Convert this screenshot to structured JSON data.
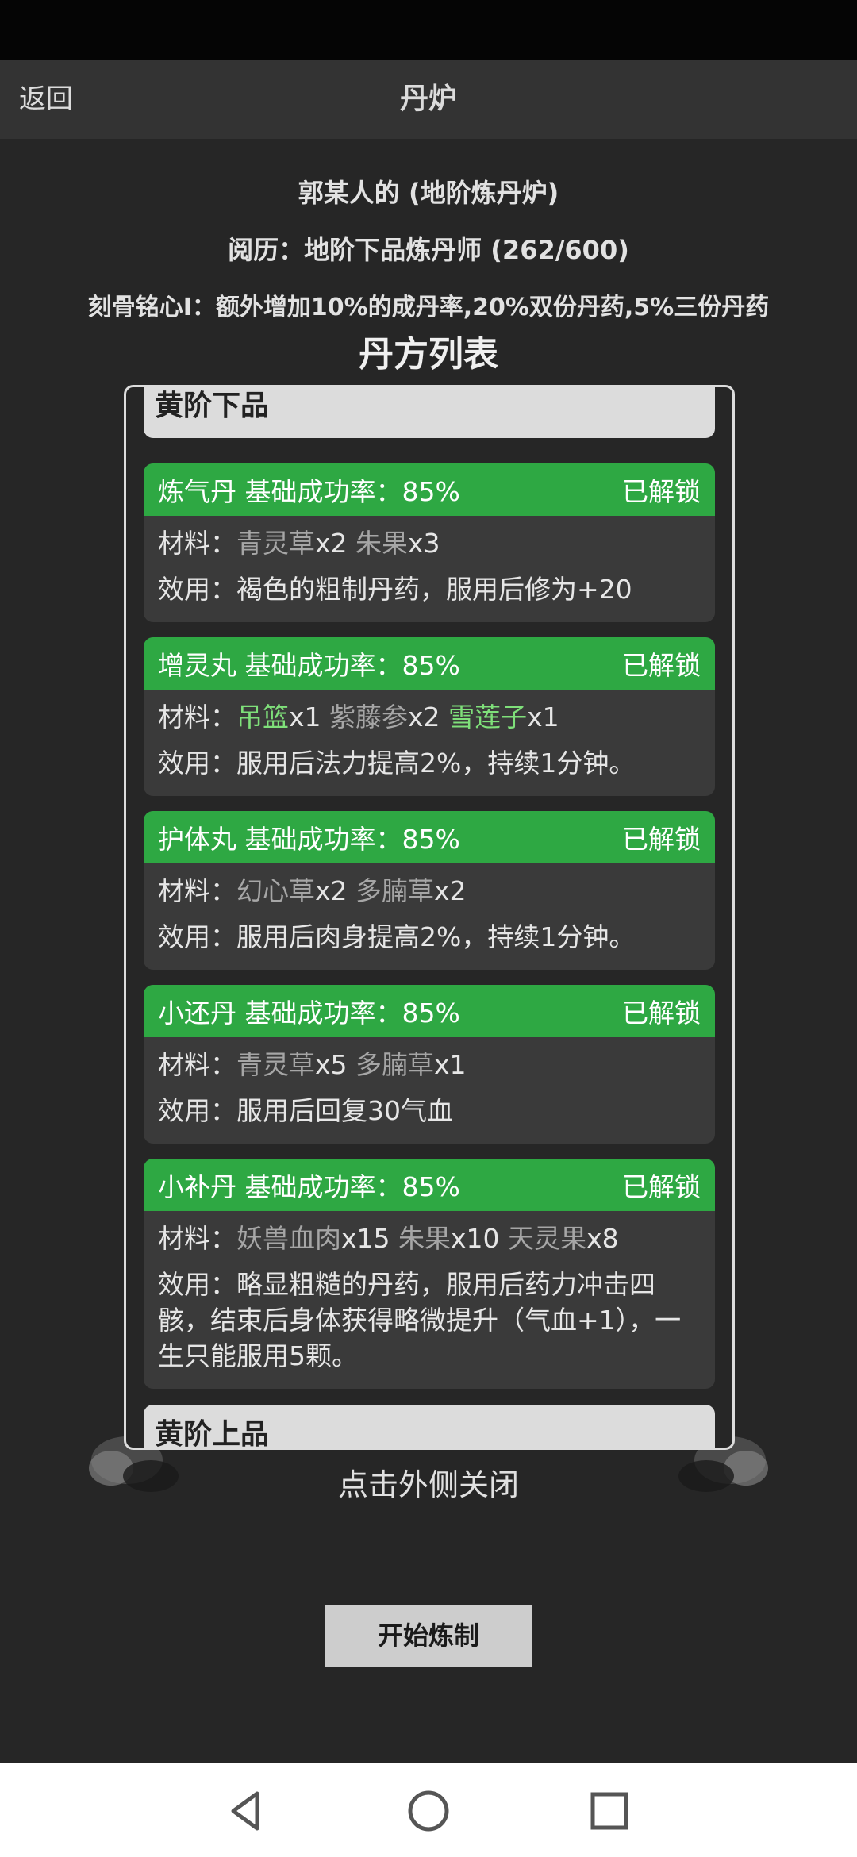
{
  "nav": {
    "back_label": "返回",
    "title": "丹炉"
  },
  "info": {
    "owner_line": "郭某人的 (地阶炼丹炉)",
    "experience_line": "阅历：地阶下品炼丹师 (262/600)",
    "bonus_line": "刻骨铭心I：额外增加10%的成丹率,20%双份丹药,5%三份丹药"
  },
  "list_title": "丹方列表",
  "tiers": {
    "top": "黄阶下品",
    "bottom": "黄阶上品"
  },
  "labels": {
    "materials": "材料：",
    "effect": "效用："
  },
  "recipes": [
    {
      "name_rate": "炼气丹 基础成功率：85%",
      "status": "已解锁",
      "materials": [
        {
          "name": "青灵草",
          "qty": "x2",
          "rare": false
        },
        {
          "name": "朱果",
          "qty": "x3",
          "rare": false
        }
      ],
      "effect": "褐色的粗制丹药，服用后修为+20"
    },
    {
      "name_rate": "增灵丸 基础成功率：85%",
      "status": "已解锁",
      "materials": [
        {
          "name": "吊篮",
          "qty": "x1",
          "rare": true
        },
        {
          "name": "紫藤参",
          "qty": "x2",
          "rare": false
        },
        {
          "name": "雪莲子",
          "qty": "x1",
          "rare": true
        }
      ],
      "effect": "服用后法力提高2%，持续1分钟。"
    },
    {
      "name_rate": "护体丸 基础成功率：85%",
      "status": "已解锁",
      "materials": [
        {
          "name": "幻心草",
          "qty": "x2",
          "rare": false
        },
        {
          "name": "多腩草",
          "qty": "x2",
          "rare": false
        }
      ],
      "effect": "服用后肉身提高2%，持续1分钟。"
    },
    {
      "name_rate": "小还丹 基础成功率：85%",
      "status": "已解锁",
      "materials": [
        {
          "name": "青灵草",
          "qty": "x5",
          "rare": false
        },
        {
          "name": "多腩草",
          "qty": "x1",
          "rare": false
        }
      ],
      "effect": "服用后回复30气血"
    },
    {
      "name_rate": "小补丹 基础成功率：85%",
      "status": "已解锁",
      "materials": [
        {
          "name": "妖兽血肉",
          "qty": "x15",
          "rare": false
        },
        {
          "name": "朱果",
          "qty": "x10",
          "rare": false
        },
        {
          "name": "天灵果",
          "qty": "x8",
          "rare": false
        }
      ],
      "effect": "略显粗糙的丹药，服用后药力冲击四骸，结束后身体获得略微提升（气血+1），一生只能服用5颗。"
    }
  ],
  "close_hint": "点击外侧关闭",
  "start_button": "开始炼制",
  "colors": {
    "background": "#262626",
    "header_green": "#2ea843",
    "rare_material": "#7fe07a",
    "common_material": "#a6a6a6",
    "tier_header": "#dcdcdc"
  },
  "icons": {
    "back": "triangle-back-icon",
    "home": "circle-home-icon",
    "recent": "square-recents-icon"
  }
}
